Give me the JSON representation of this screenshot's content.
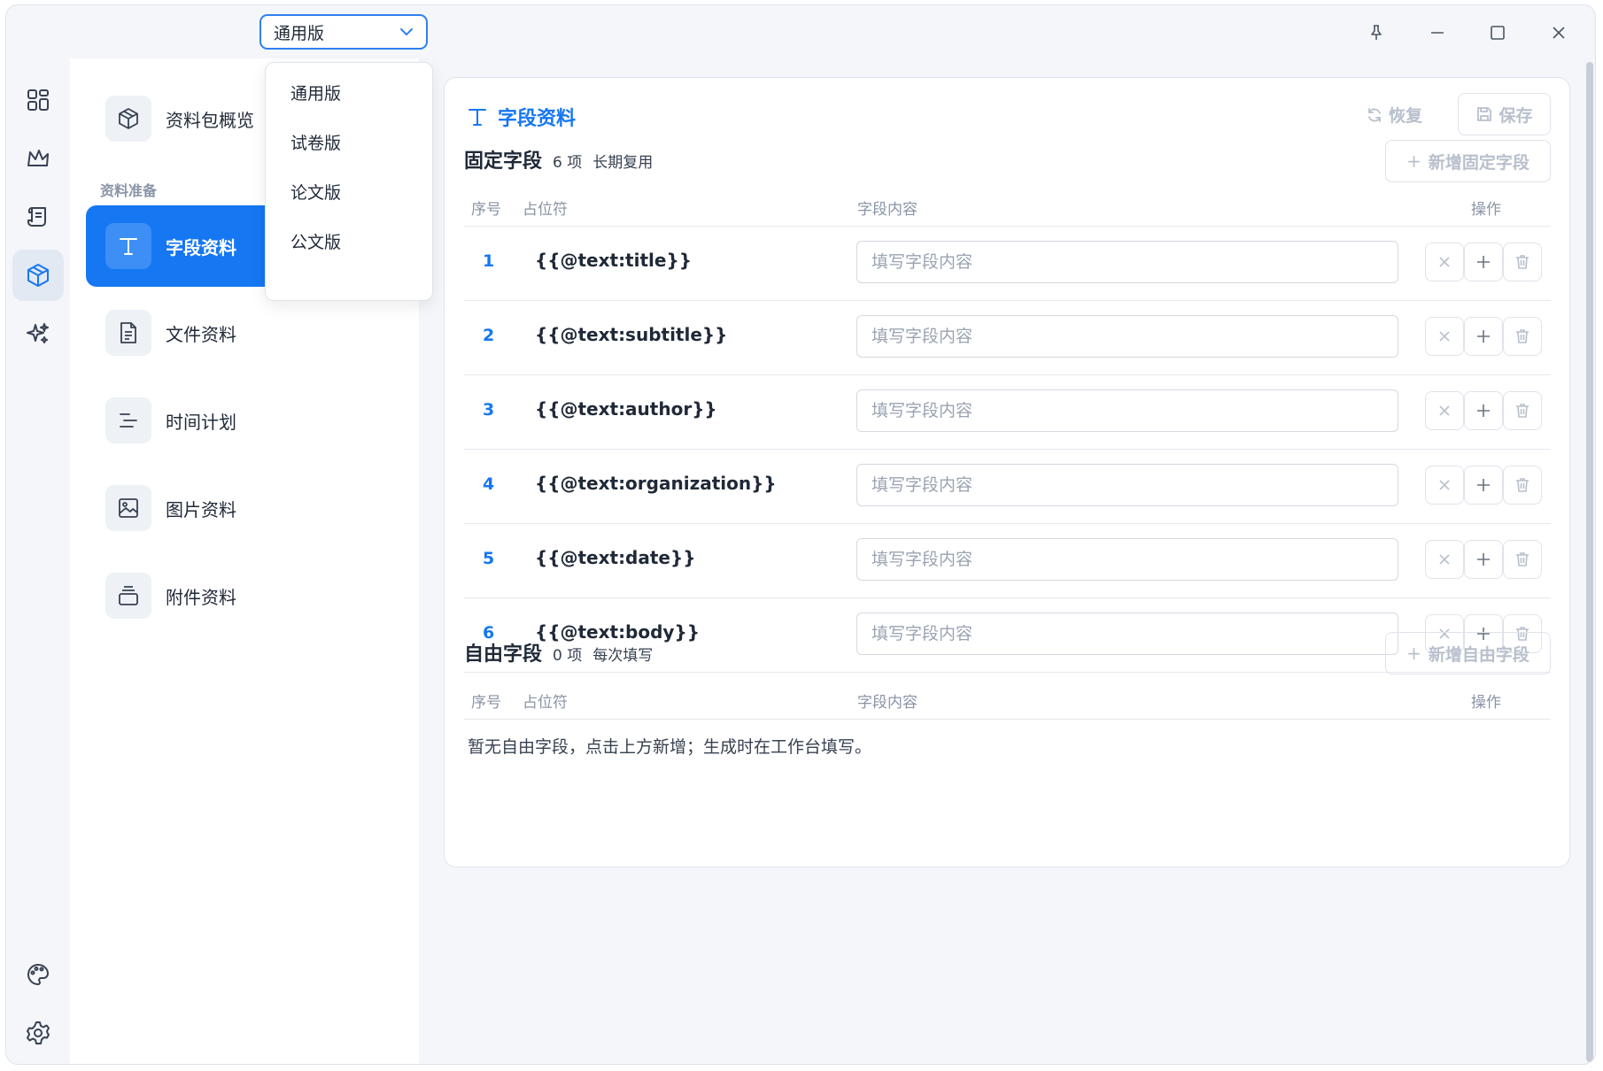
{
  "titlebar": {
    "version_selected": "通用版"
  },
  "dropdown": {
    "options": [
      "通用版",
      "试卷版",
      "论文版",
      "公文版"
    ]
  },
  "rail": {
    "items": [
      "dashboard-icon",
      "crown-icon",
      "scroll-icon",
      "package-icon",
      "sparkles-icon"
    ],
    "bottom": [
      "palette-icon",
      "gear-icon"
    ],
    "active": "package-icon"
  },
  "sidebar": {
    "overview_label": "资料包概览",
    "section_label": "资料准备",
    "items": [
      {
        "label": "字段资料",
        "icon": "text-icon"
      },
      {
        "label": "文件资料",
        "icon": "file-icon"
      },
      {
        "label": "时间计划",
        "icon": "timeline-icon"
      },
      {
        "label": "图片资料",
        "icon": "image-icon"
      },
      {
        "label": "附件资料",
        "icon": "archive-icon"
      }
    ]
  },
  "panel": {
    "title": "字段资料",
    "restore_label": "恢复",
    "save_label": "保存",
    "fixed": {
      "title": "固定字段",
      "count": "6 项",
      "note": "长期复用",
      "add_label": "新增固定字段",
      "columns": {
        "index": "序号",
        "placeholder": "占位符",
        "content": "字段内容",
        "actions": "操作"
      },
      "input_placeholder": "填写字段内容",
      "rows": [
        {
          "index": "1",
          "placeholder": "{{@text:title}}"
        },
        {
          "index": "2",
          "placeholder": "{{@text:subtitle}}"
        },
        {
          "index": "3",
          "placeholder": "{{@text:author}}"
        },
        {
          "index": "4",
          "placeholder": "{{@text:organization}}"
        },
        {
          "index": "5",
          "placeholder": "{{@text:date}}"
        },
        {
          "index": "6",
          "placeholder": "{{@text:body}}"
        }
      ]
    },
    "free": {
      "title": "自由字段",
      "count": "0 项",
      "note": "每次填写",
      "add_label": "新增自由字段",
      "columns": {
        "index": "序号",
        "placeholder": "占位符",
        "content": "字段内容",
        "actions": "操作"
      },
      "empty_message": "暂无自由字段，点击上方新增；生成时在工作台填写。"
    }
  },
  "colors": {
    "accent": "#1677f2",
    "muted": "#8a94a6",
    "disabled": "#b8c0cc"
  }
}
